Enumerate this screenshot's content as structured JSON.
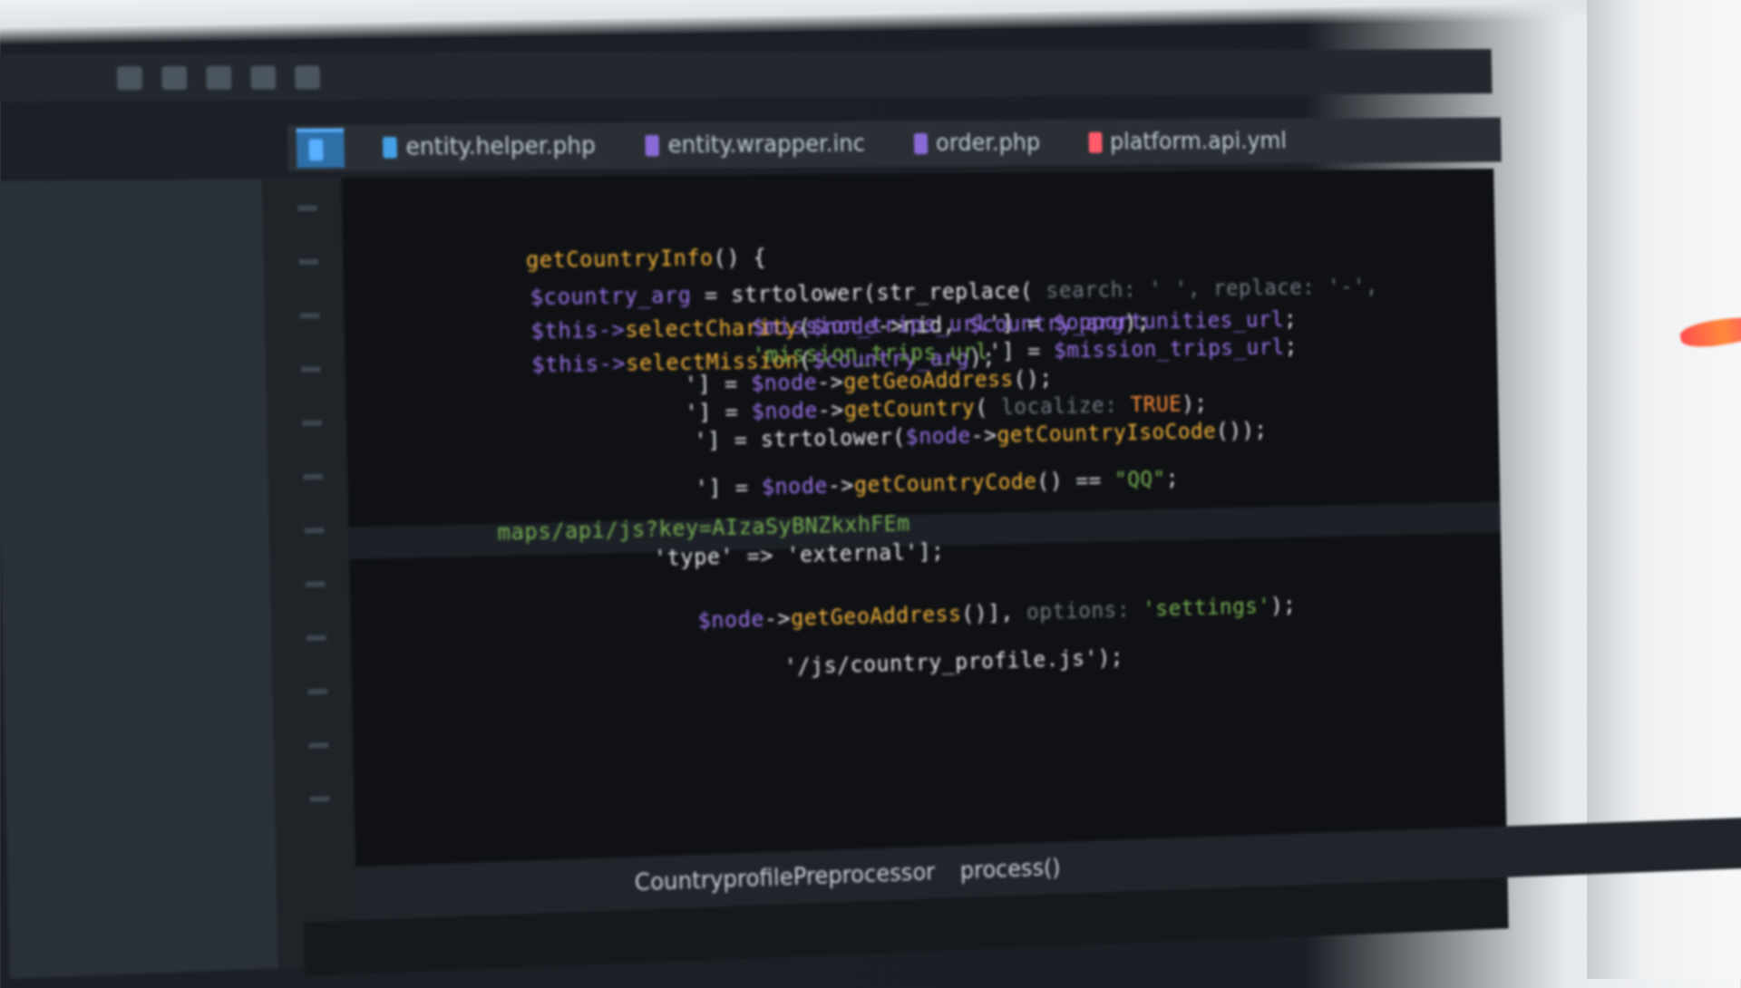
{
  "window": {
    "tabs": [
      {
        "label": "",
        "icon": "php-file-icon",
        "color": "#5ab0ff",
        "active": true
      },
      {
        "label": "entity.helper.php",
        "icon": "php-file-icon",
        "color": "#45a0e6"
      },
      {
        "label": "entity.wrapper.inc",
        "icon": "inc-file-icon",
        "color": "#8a6ad6"
      },
      {
        "label": "order.php",
        "icon": "php-file-icon",
        "color": "#8a6ad6"
      },
      {
        "label": "platform.api.yml",
        "icon": "yml-file-icon",
        "color": "#ff5b6b"
      }
    ]
  },
  "code": {
    "lines": [
      [
        {
          "t": "$mission_trips_url",
          "c": "v"
        },
        {
          "t": "'] = ",
          "c": "w"
        },
        {
          "t": "$opportunities_url",
          "c": "v"
        },
        {
          "t": ";",
          "c": "w"
        }
      ],
      [
        {
          "t": "'mission_trips_url",
          "c": "s"
        },
        {
          "t": "'] = ",
          "c": "w"
        },
        {
          "t": "$mission_trips_url",
          "c": "v"
        },
        {
          "t": ";",
          "c": "w"
        }
      ],
      [
        {
          "t": "'] = ",
          "c": "w"
        },
        {
          "t": "$node",
          "c": "v"
        },
        {
          "t": "->",
          "c": "w"
        },
        {
          "t": "getGeoAddress",
          "c": "f"
        },
        {
          "t": "();",
          "c": "w"
        }
      ],
      [
        {
          "t": "'] = ",
          "c": "w"
        },
        {
          "t": "$node",
          "c": "v"
        },
        {
          "t": "->",
          "c": "w"
        },
        {
          "t": "getCountry",
          "c": "f"
        },
        {
          "t": "( ",
          "c": "w"
        },
        {
          "t": "localize:",
          "c": "h"
        },
        {
          "t": " TRUE",
          "c": "k"
        },
        {
          "t": ");",
          "c": "w"
        }
      ],
      [
        {
          "t": "'] = strtolower(",
          "c": "w"
        },
        {
          "t": "$node",
          "c": "v"
        },
        {
          "t": "->",
          "c": "w"
        },
        {
          "t": "getCountryIsoCode",
          "c": "f"
        },
        {
          "t": "());",
          "c": "w"
        }
      ],
      [
        {
          "t": "'] = ",
          "c": "w"
        },
        {
          "t": "$node",
          "c": "v"
        },
        {
          "t": "->",
          "c": "w"
        },
        {
          "t": "getCountryCode",
          "c": "f"
        },
        {
          "t": "() == ",
          "c": "w"
        },
        {
          "t": "\"QQ\"",
          "c": "s"
        },
        {
          "t": ";",
          "c": "w"
        }
      ],
      [
        {
          "t": "maps/api/js?key=AIzaSyBNZkxhFEm",
          "c": "s"
        }
      ],
      [
        {
          "t": "'type' => 'external'",
          "c": "w"
        },
        {
          "t": "];",
          "c": "w"
        }
      ],
      [
        {
          "t": "$node",
          "c": "v"
        },
        {
          "t": "->",
          "c": "w"
        },
        {
          "t": "getGeoAddress",
          "c": "f"
        },
        {
          "t": "()], ",
          "c": "w"
        },
        {
          "t": "options:",
          "c": "h"
        },
        {
          "t": " 'settings'",
          "c": "s"
        },
        {
          "t": ");",
          "c": "w"
        }
      ],
      [
        {
          "t": "'/js/country_profile.js'",
          "c": "w"
        },
        {
          "t": ");",
          "c": "w"
        }
      ]
    ]
  },
  "status": {
    "items": [
      "CountryprofilePreprocessor",
      "process()"
    ]
  }
}
